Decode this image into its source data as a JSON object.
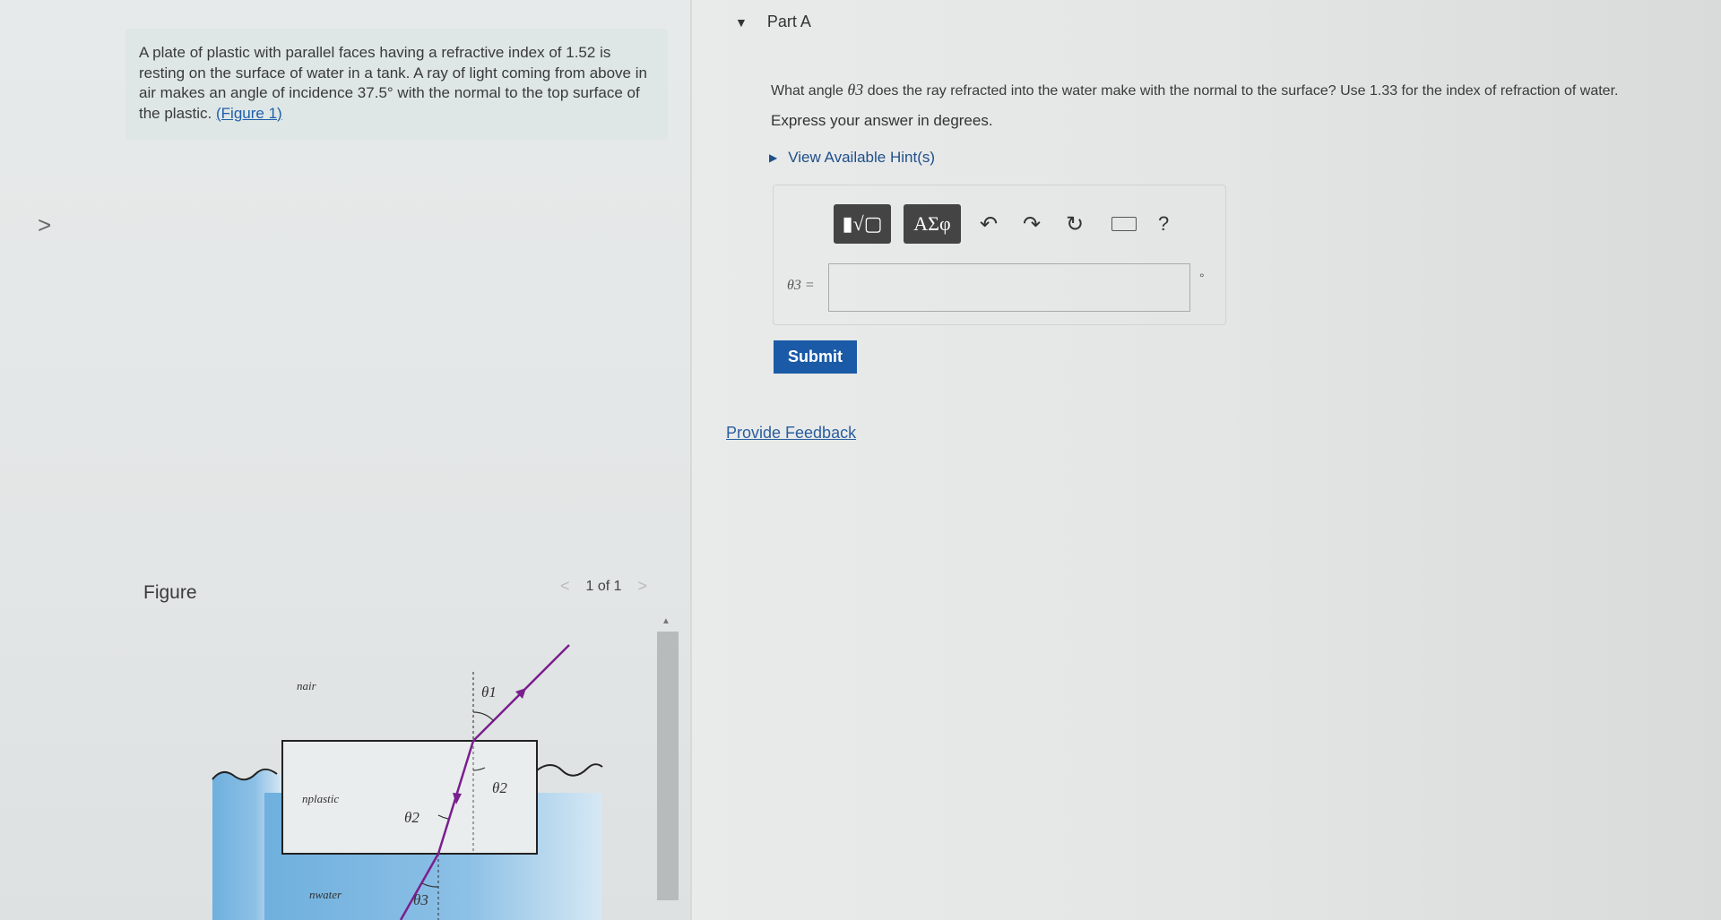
{
  "nav": {
    "expand_arrow": ">"
  },
  "problem": {
    "intro_text": "A plate of plastic with parallel faces having a refractive index of 1.52 is resting on the surface of water in a tank. A ray of light coming from above in air makes an angle of incidence 37.5° with the normal to the top surface of the plastic.",
    "figure_link": "(Figure 1)"
  },
  "figure": {
    "title": "Figure",
    "pager_prev": "<",
    "pager_text": "1 of 1",
    "pager_next": ">",
    "labels": {
      "n_air": "nair",
      "n_plastic": "nplastic",
      "n_water": "nwater",
      "theta1": "θ1",
      "theta2_top": "θ2",
      "theta2_left": "θ2",
      "theta3": "θ3"
    }
  },
  "part": {
    "title": "Part A",
    "question_before": "What angle",
    "question_symbol": "θ3",
    "question_after": "does the ray refracted into the water make with the normal to the surface? Use 1.33 for the index of refraction of water.",
    "instruction": "Express your answer in degrees.",
    "hint_label": "View Available Hint(s)",
    "toolbar": {
      "math_label": "▮√▢",
      "greek_label": "ΑΣφ",
      "undo": "↶",
      "redo": "↷",
      "reset": "↻",
      "help": "?"
    },
    "answer_label": "θ3 =",
    "answer_value": "",
    "unit": "°",
    "submit_label": "Submit",
    "feedback_label": "Provide Feedback"
  },
  "colors": {
    "submit_bg": "#1b5aa6",
    "link": "#1f5fa8",
    "ray": "#7a1f8e",
    "water": "#5aa2d8"
  },
  "icons": [
    "expand-arrow-icon",
    "collapse-triangle-icon",
    "hint-triangle-icon",
    "undo-icon",
    "redo-icon",
    "reset-icon",
    "keyboard-icon",
    "help-icon",
    "ray-arrow-icon"
  ]
}
